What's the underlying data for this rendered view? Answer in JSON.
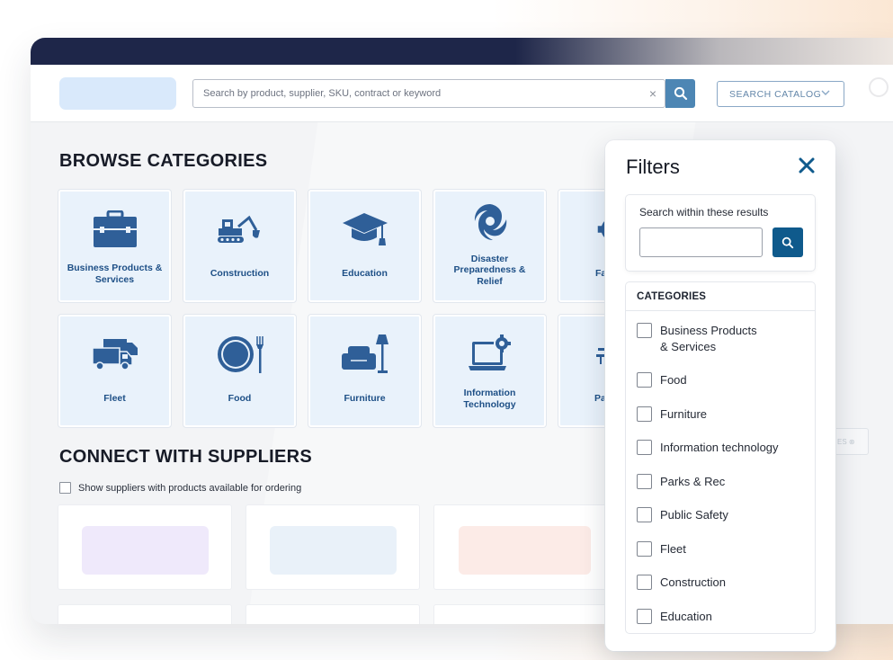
{
  "header": {
    "search_placeholder": "Search by product, supplier, SKU, contract or keyword",
    "search_clear": "×",
    "catalog_select_label": "SEARCH CATALOG"
  },
  "browse": {
    "title": "BROWSE CATEGORIES",
    "tiles": [
      {
        "label": "Business Products & Services",
        "icon": "briefcase-icon"
      },
      {
        "label": "Construction",
        "icon": "excavator-icon"
      },
      {
        "label": "Education",
        "icon": "graduation-cap-icon"
      },
      {
        "label": "Disaster Preparedness & Relief",
        "icon": "hurricane-icon"
      },
      {
        "label": "Fa",
        "icon": "gear-icon"
      },
      {
        "label": "Fleet",
        "icon": "trucks-icon"
      },
      {
        "label": "Food",
        "icon": "plate-fork-icon"
      },
      {
        "label": "Furniture",
        "icon": "armchair-lamp-icon"
      },
      {
        "label": "Information Technology",
        "icon": "laptop-gear-icon"
      },
      {
        "label": "Park",
        "icon": "park-bench-icon"
      }
    ]
  },
  "suppliers": {
    "title": "CONNECT WITH SUPPLIERS",
    "checkbox_label": "Show suppliers with products available for ordering",
    "logo_colors": [
      "#efe9fb",
      "#e9f1f9",
      "#fcebe7"
    ]
  },
  "filters": {
    "title": "Filters",
    "within_label": "Search within these results",
    "categories_heading": "CATEGORIES",
    "categories": [
      "Business Products\n& Services",
      "Food",
      "Furniture",
      "Information technology",
      "Parks & Rec",
      "Public Safety",
      "Fleet",
      "Construction",
      "Education"
    ]
  },
  "colors": {
    "navy": "#1e2649",
    "icon_blue": "#2f5f98",
    "accent_button": "#0f5a8c",
    "search_button": "#4d86b4"
  }
}
